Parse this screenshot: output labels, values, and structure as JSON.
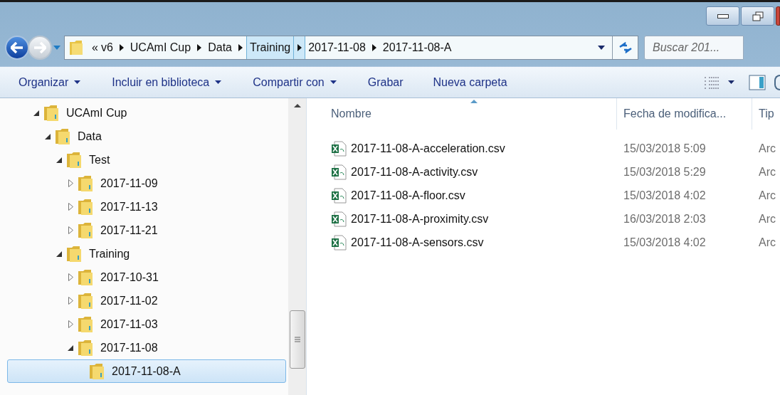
{
  "address_bar": {
    "overflow": "«",
    "crumbs": [
      {
        "label": "v6",
        "selected": false
      },
      {
        "label": "UCAmI Cup",
        "selected": false
      },
      {
        "label": "Data",
        "selected": false
      },
      {
        "label": "Training",
        "selected": true
      },
      {
        "label": "2017-11-08",
        "selected": false
      },
      {
        "label": "2017-11-08-A",
        "selected": false
      }
    ]
  },
  "search": {
    "placeholder": "Buscar 201..."
  },
  "toolbar": [
    {
      "label": "Organizar",
      "dropdown": true
    },
    {
      "label": "Incluir en biblioteca",
      "dropdown": true
    },
    {
      "label": "Compartir con",
      "dropdown": true
    },
    {
      "label": "Grabar",
      "dropdown": false
    },
    {
      "label": "Nueva carpeta",
      "dropdown": false
    }
  ],
  "tree": [
    {
      "label": "UCAmI Cup",
      "expanded": true,
      "selected": false,
      "children": [
        {
          "label": "Data",
          "expanded": true,
          "selected": false,
          "children": [
            {
              "label": "Test",
              "expanded": true,
              "selected": false,
              "children": [
                {
                  "label": "2017-11-09",
                  "expanded": false,
                  "selected": false
                },
                {
                  "label": "2017-11-13",
                  "expanded": false,
                  "selected": false
                },
                {
                  "label": "2017-11-21",
                  "expanded": false,
                  "selected": false
                }
              ]
            },
            {
              "label": "Training",
              "expanded": true,
              "selected": false,
              "children": [
                {
                  "label": "2017-10-31",
                  "expanded": false,
                  "selected": false
                },
                {
                  "label": "2017-11-02",
                  "expanded": false,
                  "selected": false
                },
                {
                  "label": "2017-11-03",
                  "expanded": false,
                  "selected": false
                },
                {
                  "label": "2017-11-08",
                  "expanded": true,
                  "selected": false,
                  "children": [
                    {
                      "label": "2017-11-08-A",
                      "selected": true
                    }
                  ]
                }
              ]
            }
          ]
        }
      ]
    }
  ],
  "columns": [
    {
      "label": "Nombre",
      "sorted": true
    },
    {
      "label": "Fecha de modifica...",
      "sorted": false
    },
    {
      "label": "Tip",
      "sorted": false
    }
  ],
  "files": [
    {
      "name": "2017-11-08-A-acceleration.csv",
      "modified": "15/03/2018 5:09",
      "type": "Arc"
    },
    {
      "name": "2017-11-08-A-activity.csv",
      "modified": "15/03/2018 5:29",
      "type": "Arc"
    },
    {
      "name": "2017-11-08-A-floor.csv",
      "modified": "15/03/2018 4:02",
      "type": "Arc"
    },
    {
      "name": "2017-11-08-A-proximity.csv",
      "modified": "16/03/2018 2:03",
      "type": "Arc"
    },
    {
      "name": "2017-11-08-A-sensors.csv",
      "modified": "15/03/2018 4:02",
      "type": "Arc"
    }
  ]
}
